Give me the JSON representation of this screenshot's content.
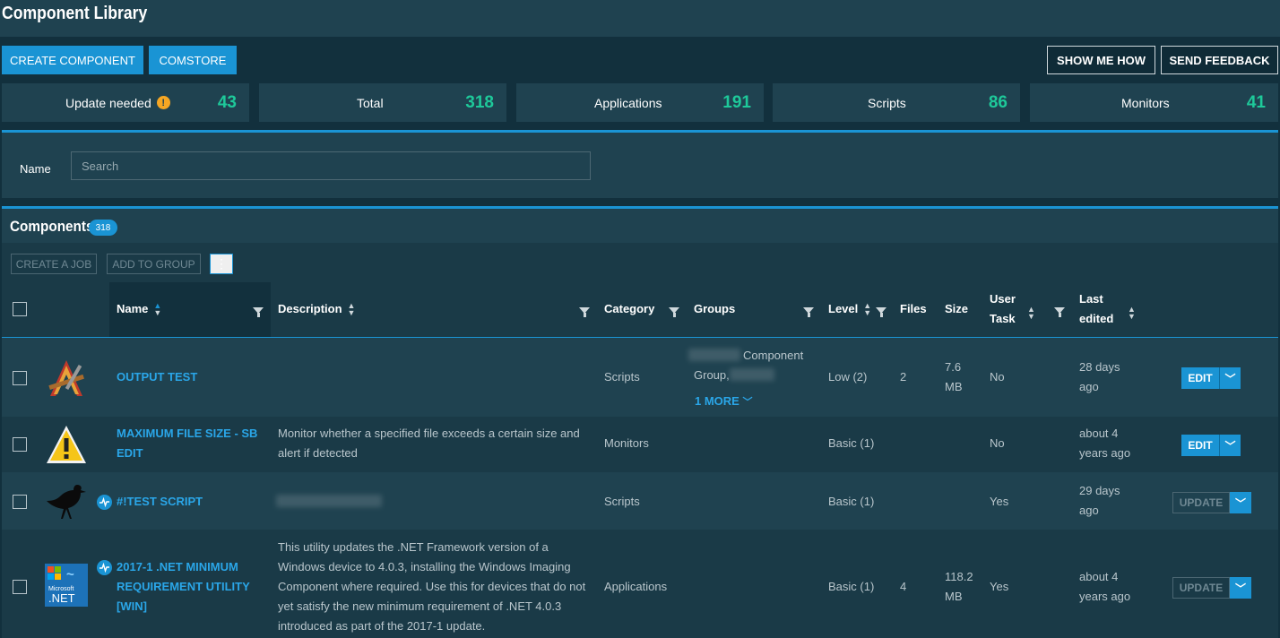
{
  "header": {
    "title": "Component Library"
  },
  "actions": {
    "create_component": "CREATE COMPONENT",
    "comstore": "COMSTORE",
    "show_me_how": "SHOW ME HOW",
    "send_feedback": "SEND FEEDBACK"
  },
  "stats": [
    {
      "label": "Update needed",
      "value": "43",
      "warning": true
    },
    {
      "label": "Total",
      "value": "318"
    },
    {
      "label": "Applications",
      "value": "191"
    },
    {
      "label": "Scripts",
      "value": "86"
    },
    {
      "label": "Monitors",
      "value": "41"
    }
  ],
  "filter": {
    "name_label": "Name",
    "search_placeholder": "Search"
  },
  "components": {
    "title": "Components",
    "count": "318",
    "toolbar": {
      "create_job": "CREATE A JOB",
      "add_to_group": "ADD TO GROUP",
      "more": "⋮"
    },
    "columns": {
      "name": "Name",
      "description": "Description",
      "category": "Category",
      "groups": "Groups",
      "level": "Level",
      "files": "Files",
      "size": "Size",
      "user_task_1": "User",
      "user_task_2": "Task",
      "last_edited_1": "Last",
      "last_edited_2": "edited"
    },
    "rows": [
      {
        "icon": "compiler-tools-icon",
        "name": "OUTPUT TEST",
        "description": "",
        "category": "Scripts",
        "groups_1": "Component",
        "groups_2": "Group,",
        "groups_more": "1 MORE",
        "level": "Low (2)",
        "files": "2",
        "size_1": "7.6",
        "size_2": "MB",
        "user_task": "No",
        "edited_1": "28 days",
        "edited_2": "ago",
        "action": "EDIT"
      },
      {
        "icon": "warning-triangle-icon",
        "name_1": "MAXIMUM FILE SIZE - SB",
        "name_2": "EDIT",
        "description_1": "Monitor whether a specified file exceeds a certain size and",
        "description_2": "alert if detected",
        "category": "Monitors",
        "level": "Basic (1)",
        "files": "",
        "user_task": "No",
        "edited_1": "about 4",
        "edited_2": "years ago",
        "action": "EDIT"
      },
      {
        "icon": "bird-silhouette-icon",
        "name": "#!TEST SCRIPT",
        "category": "Scripts",
        "level": "Basic (1)",
        "user_task": "Yes",
        "edited_1": "29 days",
        "edited_2": "ago",
        "action": "UPDATE"
      },
      {
        "icon": "dotnet-logo-icon",
        "name_1": "2017-1 .NET MINIMUM",
        "name_2": "REQUIREMENT UTILITY",
        "name_3": "[WIN]",
        "description_1": "This utility updates the .NET Framework version of a",
        "description_2": "Windows device to 4.0.3, installing the Windows Imaging",
        "description_3": "Component where required. Use this for devices that do not",
        "description_4": "yet satisfy the new minimum requirement of .NET 4.0.3",
        "description_5": "introduced as part of the 2017-1 update.",
        "category": "Applications",
        "level": "Basic (1)",
        "files": "4",
        "size_1": "118.2",
        "size_2": "MB",
        "user_task": "Yes",
        "edited_1": "about 4",
        "edited_2": "years ago",
        "action": "UPDATE",
        "logo_text_1": "Microsoft",
        "logo_text_2": ".NET"
      }
    ]
  }
}
